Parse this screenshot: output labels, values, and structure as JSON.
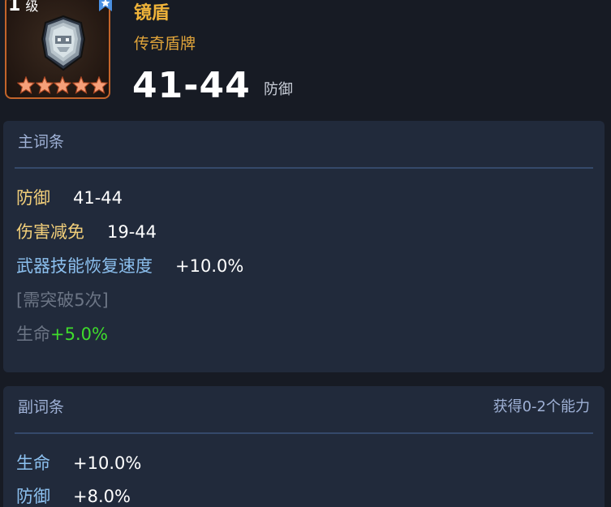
{
  "item": {
    "level_num": "1",
    "level_unit": "级",
    "name": "镜盾",
    "rarity": "传奇盾牌",
    "stat_value": "41-44",
    "stat_unit": "防御",
    "stars": 5,
    "icon": "mirror-shield-icon"
  },
  "main_affixes": {
    "title": "主词条",
    "rows": [
      {
        "label": "防御",
        "value": "41-44"
      },
      {
        "label": "伤害减免",
        "value": "19-44"
      },
      {
        "label": "武器技能恢复速度",
        "value": "+10.0%"
      }
    ],
    "requirement": "[需突破5次]",
    "locked_label": "生命",
    "locked_value": "+5.0%"
  },
  "sub_affixes": {
    "title": "副词条",
    "note": "获得0-2个能力",
    "rows": [
      {
        "label": "生命",
        "value": "+10.0%"
      },
      {
        "label": "防御",
        "value": "+8.0%"
      }
    ]
  },
  "colors": {
    "background": "#171b24",
    "panel": "#212a3b",
    "legendary_gold": "#f0b43a",
    "stat_green": "#3fdc2c",
    "affix_blue": "#8cc0ef",
    "frame_orange": "#c3642a"
  }
}
